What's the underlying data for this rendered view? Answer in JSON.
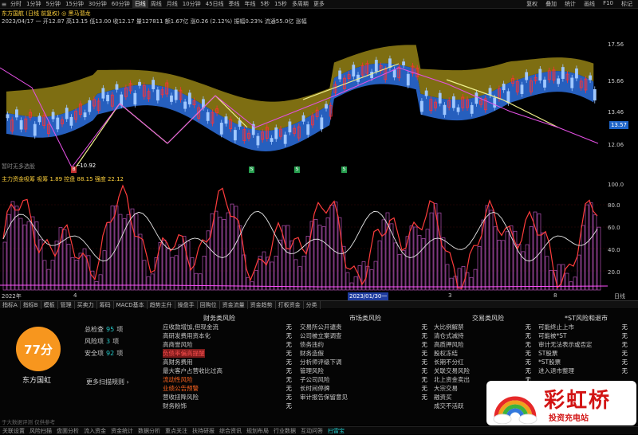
{
  "toolbar": {
    "periods": [
      "分时",
      "1分钟",
      "5分钟",
      "15分钟",
      "30分钟",
      "60分钟",
      "日线",
      "周线",
      "月线",
      "10分钟",
      "45日线",
      "季线",
      "年线",
      "5秒",
      "15秒",
      "多周期",
      "更多"
    ],
    "active_period": "日线",
    "right_buttons": [
      "复权",
      "叠加",
      "统计",
      "画线",
      "F10",
      "标记"
    ]
  },
  "chart": {
    "title": "东方国航 (日线 前复权) ◎ 黑马潜龙",
    "stats": "2023/04/17 一 开12.87 高13.15 低13.00 收12.17 量127811 额1.67亿 涨0.26 (2.12%) 振幅0.23% 流通55.0亿 涨幅",
    "price_labels": [
      "17.56",
      "15.66",
      "13.46",
      "12.06"
    ],
    "current_price": "13.57",
    "low_label": "─10.92",
    "markers": [
      "B",
      "S",
      "S",
      "S"
    ],
    "note": "暂时无多选股"
  },
  "indicator": {
    "title": "主力资金吸筹 吸筹  1.89  控盘  88.15  强度  22.12",
    "axis": [
      "100.0",
      "80.0",
      "60.0",
      "40.0",
      "20.0"
    ],
    "dates": [
      "2022年",
      "4",
      "2023/01/30一",
      "3",
      "8",
      "日线"
    ]
  },
  "tabs": [
    "指标A",
    "指标B",
    "模板",
    "管理",
    "买卖力",
    "筹码",
    "MACD基本",
    "趋势主升",
    "操盘手",
    "回购位",
    "资金流量",
    "资金趋势",
    "打板资金",
    "分类"
  ],
  "diagnosis": {
    "score": "77分",
    "stock_name": "东方国虹",
    "total_label": "总检查",
    "total_value": "95",
    "total_unit": "项",
    "risk_label": "风险项",
    "risk_value": "3",
    "risk_unit": "项",
    "safe_label": "安全项",
    "safe_value": "92",
    "safe_unit": "项",
    "more": "更多扫描规则 ›",
    "columns": [
      {
        "title": "财务类风险",
        "items": [
          {
            "label": "应收款增加,但现金流",
            "status": "无"
          },
          {
            "label": "高研发费用资本化",
            "status": "无"
          },
          {
            "label": "高商誉风险",
            "status": "无"
          },
          {
            "label": "负债率偏高提醒",
            "status": "无",
            "flag": "hl2"
          },
          {
            "label": "高财务费用",
            "status": "无"
          },
          {
            "label": "最大客户占营收比过高",
            "status": "无"
          },
          {
            "label": "流动性风险",
            "status": "无",
            "flag": "hl"
          },
          {
            "label": "业绩公告预警",
            "status": "无",
            "flag": "hl"
          },
          {
            "label": "营收扭降风险",
            "status": "无"
          },
          {
            "label": "财务粉饰",
            "status": "无"
          }
        ]
      },
      {
        "title": "市场类风险",
        "items": [
          {
            "label": "交易所公开谴责",
            "status": "无"
          },
          {
            "label": "公司被立案调查",
            "status": "无"
          },
          {
            "label": "债务违约",
            "status": "无"
          },
          {
            "label": "财务造假",
            "status": "无"
          },
          {
            "label": "分析师评级下调",
            "status": "无"
          },
          {
            "label": "管理风险",
            "status": "无"
          },
          {
            "label": "子公司风险",
            "status": "无"
          },
          {
            "label": "长时间停牌",
            "status": "无"
          },
          {
            "label": "审计报告保留意见",
            "status": "无"
          }
        ]
      },
      {
        "title": "交易类风险",
        "items": [
          {
            "label": "大比例解禁",
            "status": "无"
          },
          {
            "label": "清仓式减持",
            "status": "无"
          },
          {
            "label": "高质押风险",
            "status": "无"
          },
          {
            "label": "股权冻结",
            "status": "无"
          },
          {
            "label": "长期不分红",
            "status": "无"
          },
          {
            "label": "关联交易风险",
            "status": "无"
          },
          {
            "label": "北上资金卖出",
            "status": "无"
          },
          {
            "label": "大宗交易",
            "status": "无"
          },
          {
            "label": "融资买",
            "status": "无"
          },
          {
            "label": "成交不活跃",
            "status": "无"
          }
        ]
      },
      {
        "title": "*ST风险和退市",
        "items": [
          {
            "label": "可能终止上市",
            "status": "无"
          },
          {
            "label": "可能被*ST",
            "status": "无"
          },
          {
            "label": "审计无法表示或否定",
            "status": "无"
          },
          {
            "label": "ST股票",
            "status": "无"
          },
          {
            "label": "*ST股票",
            "status": "无"
          },
          {
            "label": "进入退市整理",
            "status": "无"
          }
        ]
      }
    ],
    "disclaimer": "于大数据评测 仅供参考"
  },
  "statusbar": [
    "关联设置",
    "风险扫描",
    "盘面分析",
    "流入资金",
    "资金统计",
    "数据分析",
    "重点关注",
    "扶持研报",
    "综合资讯",
    "规划布局",
    "行业数据",
    "互动问答",
    "扫雷宝"
  ],
  "logo": {
    "title": "彩虹桥",
    "subtitle": "投资充电站"
  },
  "colors": {
    "up": "#ff3232",
    "down": "#3c8cff",
    "cloud_upper": "#8c7a14",
    "cloud_lower": "#2864c8",
    "accent": "#23c8c8"
  }
}
